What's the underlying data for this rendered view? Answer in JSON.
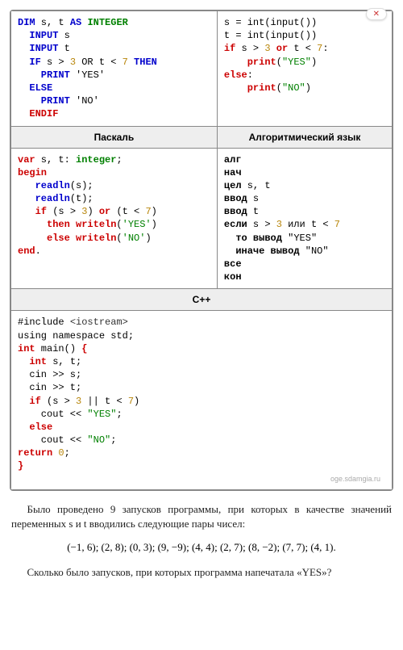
{
  "close_badge": "✕",
  "headers": {
    "pascal": "Паскаль",
    "algo": "Алгоритмический язык",
    "cpp": "С++"
  },
  "basic": {
    "l1a": "DIM",
    "l1b": " s, t ",
    "l1c": "AS",
    "l1d": " ",
    "l1e": "INTEGER",
    "l2a": "  INPUT",
    "l2b": " s",
    "l3a": "  INPUT",
    "l3b": " t",
    "l4a": "  IF",
    "l4b": " s > ",
    "l4c": "3",
    "l4d": " OR t < ",
    "l4e": "7",
    "l4f": " THEN",
    "l5a": "    PRINT",
    "l5b": " 'YES'",
    "l6a": "  ELSE",
    "l7a": "    PRINT",
    "l7b": " 'NO'",
    "l8a": "  ENDIF"
  },
  "python": {
    "l1": "s = int(input())",
    "l2": "t = int(input())",
    "l3a": "if",
    "l3b": " s > ",
    "l3c": "3",
    "l3d": " ",
    "l3e": "or",
    "l3f": " t < ",
    "l3g": "7",
    "l3h": ":",
    "l4a": "    print",
    "l4b": "(",
    "l4c": "\"YES\"",
    "l4d": ")",
    "l5a": "else",
    "l5b": ":",
    "l6a": "    print",
    "l6b": "(",
    "l6c": "\"NO\"",
    "l6d": ")"
  },
  "pascal": {
    "l1a": "var",
    "l1b": " s, t: ",
    "l1c": "integer",
    "l1d": ";",
    "l2a": "begin",
    "l3a": "   readln",
    "l3b": "(s);",
    "l4a": "   readln",
    "l4b": "(t);",
    "l5a": "   if",
    "l5b": " (s > ",
    "l5c": "3",
    "l5d": ") ",
    "l5e": "or",
    "l5f": " (t < ",
    "l5g": "7",
    "l5h": ")",
    "l6a": "     then writeln",
    "l6b": "(",
    "l6c": "'YES'",
    "l6d": ")",
    "l7a": "     else writeln",
    "l7b": "(",
    "l7c": "'NO'",
    "l7d": ")",
    "l8a": "end",
    "l8b": "."
  },
  "algo": {
    "l1": "алг",
    "l2": "нач",
    "l3a": "цел",
    "l3b": " s, t",
    "l4a": "ввод",
    "l4b": " s",
    "l5a": "ввод",
    "l5b": " t",
    "l6a": "если",
    "l6b": " s > ",
    "l6c": "3",
    "l6d": " или t < ",
    "l6e": "7",
    "l7a": "  то вывод ",
    "l7b": "\"YES\"",
    "l8a": "  иначе вывод ",
    "l8b": "\"NO\"",
    "l9": "все",
    "l10": "кон"
  },
  "cpp": {
    "l1a": "#include ",
    "l1b": "<iostream>",
    "l2": "using namespace std;",
    "l3a": "int",
    "l3b": " main() ",
    "l3c": "{",
    "l4a": "  int",
    "l4b": " s, t;",
    "l5": "  cin >> s;",
    "l6": "  cin >> t;",
    "l7a": "  if",
    "l7b": " (s > ",
    "l7c": "3",
    "l7d": " || t < ",
    "l7e": "7",
    "l7f": ")",
    "l8a": "    cout << ",
    "l8b": "\"YES\"",
    "l8c": ";",
    "l9a": "  else",
    "l10a": "    cout << ",
    "l10b": "\"NO\"",
    "l10c": ";",
    "l11a": "return",
    "l11b": " ",
    "l11c": "0",
    "l11d": ";",
    "l12": "}"
  },
  "watermark": "oge.sdamgia.ru",
  "para1": "Было проведено 9 запусков программы, при которых в качестве значений переменных s и t вводились следующие пары чисел:",
  "pairs": "(−1, 6); (2, 8); (0, 3); (9, −9); (4, 4); (2, 7); (8, −2); (7, 7); (4, 1).",
  "para2": "Сколько было запусков, при которых программа напечатала «YES»?"
}
